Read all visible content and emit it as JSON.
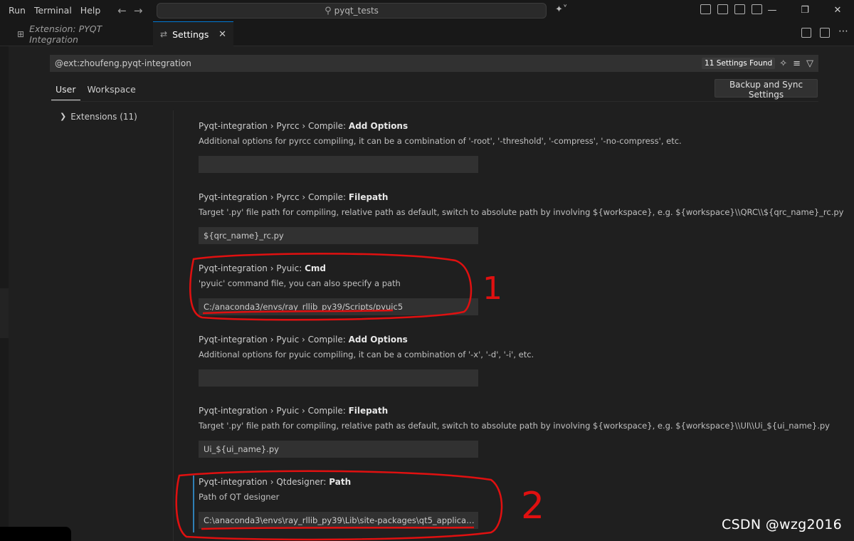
{
  "menu": {
    "items": [
      "Run",
      "Terminal",
      "Help"
    ]
  },
  "command_center": {
    "text": "pyqt_tests"
  },
  "tabs": {
    "extension": "Extension: PYQT Integration",
    "settings": "Settings"
  },
  "search": {
    "value": "@ext:zhoufeng.pyqt-integration",
    "found": "11 Settings Found"
  },
  "scope_tabs": {
    "user": "User",
    "workspace": "Workspace"
  },
  "backup_button": "Backup and Sync Settings",
  "toc": {
    "extensions": "Extensions (11)"
  },
  "settings": [
    {
      "prefix": "Pyqt-integration › Pyrcc › Compile: ",
      "key": "Add Options",
      "description": "Additional options for pyrcc compiling, it can be a combination of '-root', '-threshold', '-compress', '-no-compress', etc.",
      "value": ""
    },
    {
      "prefix": "Pyqt-integration › Pyrcc › Compile: ",
      "key": "Filepath",
      "description": "Target '.py' file path for compiling, relative path as default, switch to absolute path by involving ${workspace}, e.g. ${workspace}\\\\QRC\\\\${qrc_name}_rc.py",
      "value": "${qrc_name}_rc.py"
    },
    {
      "prefix": "Pyqt-integration › Pyuic: ",
      "key": "Cmd",
      "description": "'pyuic' command file, you can also specify a path",
      "value": "C:/anaconda3/envs/ray_rllib_py39/Scripts/pyuic5"
    },
    {
      "prefix": "Pyqt-integration › Pyuic › Compile: ",
      "key": "Add Options",
      "description": "Additional options for pyuic compiling, it can be a combination of '-x', '-d', '-i', etc.",
      "value": ""
    },
    {
      "prefix": "Pyqt-integration › Pyuic › Compile: ",
      "key": "Filepath",
      "description": "Target '.py' file path for compiling, relative path as default, switch to absolute path by involving ${workspace}, e.g. ${workspace}\\\\UI\\\\Ui_${ui_name}.py",
      "value": "Ui_${ui_name}.py"
    },
    {
      "prefix": "Pyqt-integration › Qtdesigner: ",
      "key": "Path",
      "description": "Path of QT designer",
      "value": "C:\\anaconda3\\envs\\ray_rllib_py39\\Lib\\site-packages\\qt5_applications..."
    }
  ],
  "annotations": {
    "mark_1": "1",
    "mark_2": "2",
    "color": "#e01010"
  },
  "watermark": "CSDN @wzg2016"
}
